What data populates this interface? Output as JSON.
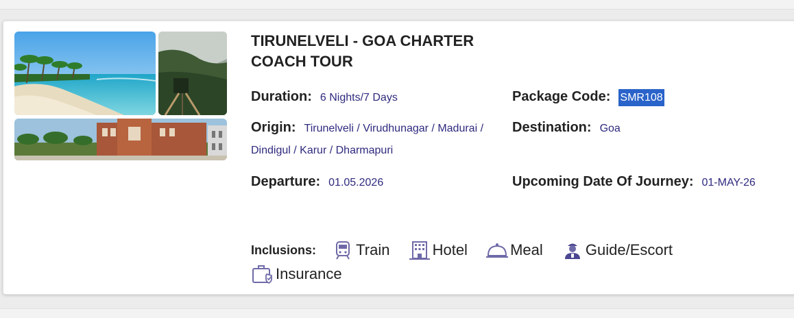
{
  "tour": {
    "title": "TIRUNELVELI - GOA CHARTER COACH TOUR",
    "duration_label": "Duration:",
    "duration": "6 Nights/7 Days",
    "code_label": "Package Code:",
    "code": "SMR108",
    "origin_label": "Origin:",
    "origin": "Tirunelveli / Virudhunagar / Madurai / Dindigul / Karur / Dharmapuri",
    "destination_label": "Destination:",
    "destination": "Goa",
    "departure_label": "Departure:",
    "departure": "01.05.2026",
    "upcoming_label": "Upcoming Date Of Journey:",
    "upcoming": "01-MAY-26"
  },
  "inclusions": {
    "label": "Inclusions:",
    "items": [
      {
        "label": "Train",
        "icon": "train-icon"
      },
      {
        "label": "Hotel",
        "icon": "hotel-icon"
      },
      {
        "label": "Meal",
        "icon": "meal-icon"
      },
      {
        "label": "Guide/Escort",
        "icon": "guide-icon"
      },
      {
        "label": "Insurance",
        "icon": "insurance-icon"
      }
    ]
  },
  "colors": {
    "value_text": "#2e2a7e",
    "highlight": "#2a63c9",
    "icon": "#6e6aa8"
  }
}
